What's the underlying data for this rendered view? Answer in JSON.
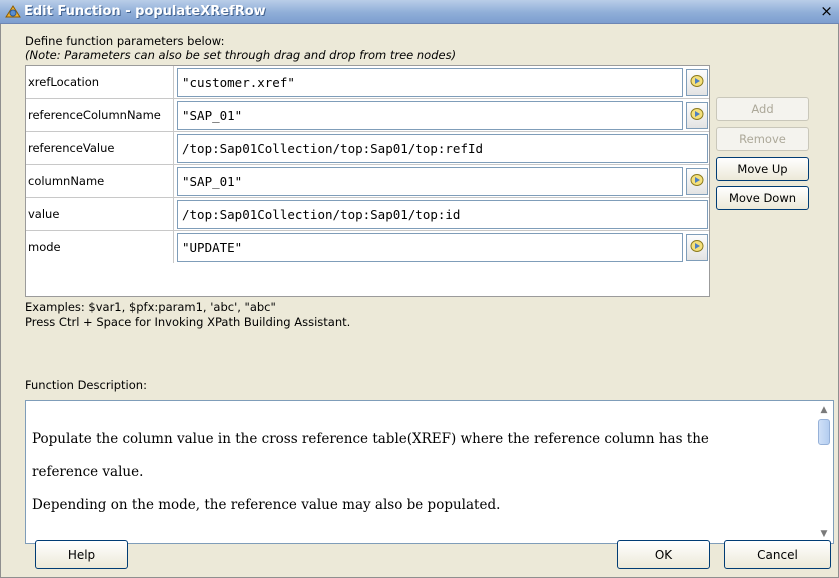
{
  "window": {
    "title": "Edit Function - populateXRefRow",
    "close_glyph": "×"
  },
  "intro": {
    "line1": "Define function parameters below:",
    "line2": "(Note: Parameters can also be set through drag and drop from tree nodes)"
  },
  "params": [
    {
      "label": "xrefLocation",
      "value": "\"customer.xref\"",
      "has_picker": true
    },
    {
      "label": "referenceColumnName",
      "value": "\"SAP_01\"",
      "has_picker": true
    },
    {
      "label": "referenceValue",
      "value": "/top:Sap01Collection/top:Sap01/top:refId",
      "has_picker": false
    },
    {
      "label": "columnName",
      "value": "\"SAP_01\"",
      "has_picker": true
    },
    {
      "label": "value",
      "value": "/top:Sap01Collection/top:Sap01/top:id",
      "has_picker": false
    },
    {
      "label": "mode",
      "value": "\"UPDATE\"",
      "has_picker": true
    }
  ],
  "side_buttons": {
    "add": "Add",
    "remove": "Remove",
    "move_up": "Move Up",
    "move_down": "Move Down"
  },
  "hints": {
    "examples": "Examples: $var1, $pfx:param1, 'abc', \"abc\"",
    "shortcut": "Press Ctrl + Space for Invoking XPath Building Assistant."
  },
  "function_description": {
    "label": "Function Description:",
    "line1": "Populate the column value in the cross reference table(XREF) where the reference column has the",
    "line2": "reference value.",
    "line3": "Depending on the mode, the reference value may also be populated."
  },
  "buttons": {
    "help": "Help",
    "ok": "OK",
    "cancel": "Cancel"
  },
  "colors": {
    "title_gradient": "#8faed8",
    "accent": "#003c74",
    "dialog_bg": "#ece9d8"
  }
}
